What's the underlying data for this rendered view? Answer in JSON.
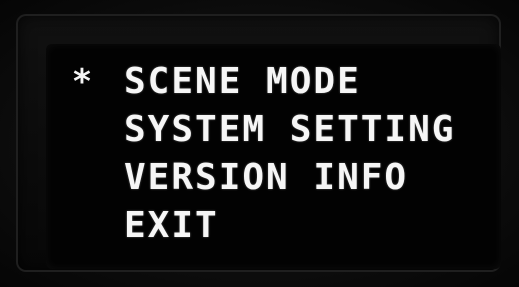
{
  "menu": {
    "cursor_glyph": "*",
    "selected_index": 0,
    "items": [
      {
        "label": "SCENE MODE"
      },
      {
        "label": "SYSTEM SETTING"
      },
      {
        "label": "VERSION INFO"
      },
      {
        "label": "EXIT"
      }
    ]
  },
  "colors": {
    "text": "#f6f6f6",
    "screen_background": "#020202"
  }
}
